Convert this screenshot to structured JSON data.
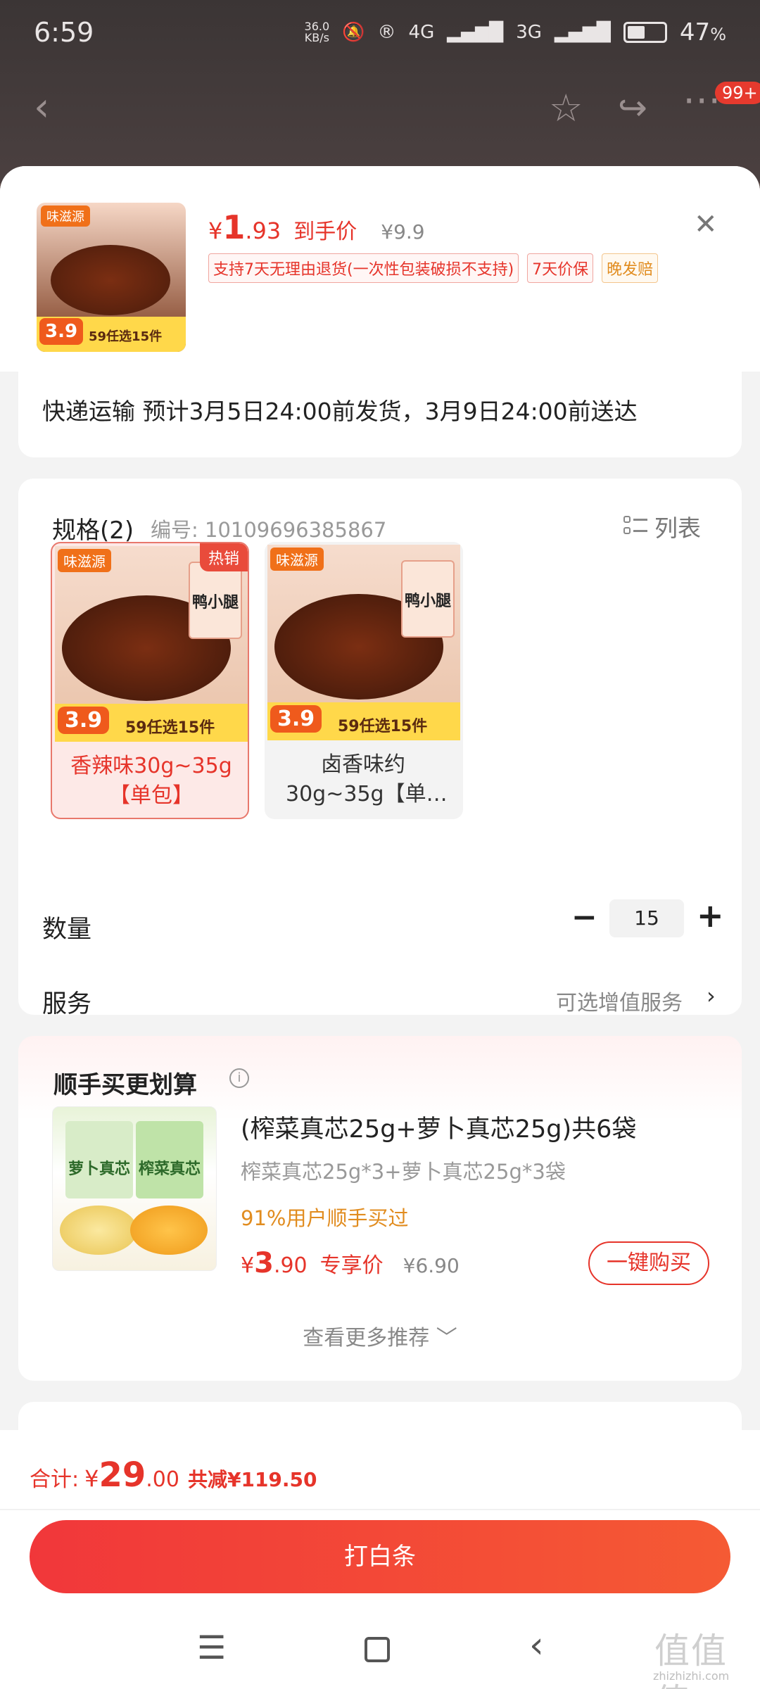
{
  "status_bar": {
    "time": "6:59",
    "net_speed": "36.0",
    "net_unit": "KB/s",
    "signal1": "4G",
    "signal2": "3G",
    "battery": "47",
    "battery_suffix": "%"
  },
  "top_nav": {
    "badge": "99+"
  },
  "product": {
    "thumb_brand": "味滋源",
    "thumb_price": "3.9",
    "thumb_promo": "59任选15件",
    "currency": "¥",
    "price_int": "1",
    "price_dec": ".93",
    "price_label": "到手价",
    "original_price": "¥9.9",
    "tags": [
      "支持7天无理由退货(一次性包装破损不支持)",
      "7天价保",
      "晚发赔"
    ]
  },
  "shipping": {
    "text": "快递运输 预计3月5日24:00前发货，3月9日24:00前送达"
  },
  "spec": {
    "title": "规格(2)",
    "code": "编号: 10109696385867",
    "list_label": "列表",
    "options": [
      {
        "name_line1": "香辣味30g~35g",
        "name_line2": "【单包】",
        "hot": "热销",
        "brand": "味滋源",
        "pack": "鸭小腿",
        "price": "3.9",
        "promo": "59任选15件"
      },
      {
        "name_line1": "卤香味约",
        "name_line2": "30g~35g【单…",
        "brand": "味滋源",
        "pack": "鸭小腿",
        "price": "3.9",
        "promo": "59任选15件"
      }
    ],
    "quantity_label": "数量",
    "quantity": "15",
    "minus": "−",
    "plus": "+",
    "service_label": "服务",
    "service_option": "可选增值服务"
  },
  "recommend": {
    "title": "顺手买更划算",
    "product_name": "(榨菜真芯25g+萝卜真芯25g)共6袋",
    "product_desc": "榨菜真芯25g*3+萝卜真芯25g*3袋",
    "bought": "91%用户顺手买过",
    "currency": "¥",
    "price_int": "3",
    "price_dec": ".90",
    "price_label": "专享价",
    "original_price": "¥6.90",
    "buy_label": "一键购买",
    "bag1": "萝卜真芯",
    "bag2": "榨菜真芯",
    "more_label": "查看更多推荐 ﹀"
  },
  "bottom": {
    "total_label": "合计:",
    "currency": "¥",
    "total_int": "29",
    "total_dec": ".00",
    "saved": "共减¥119.50",
    "pay_label": "打白条"
  },
  "watermark": {
    "text": "值值值",
    "url": "zhizhizhi.com"
  },
  "colors": {
    "accent": "#e6342a",
    "orange": "#e18c1f"
  }
}
